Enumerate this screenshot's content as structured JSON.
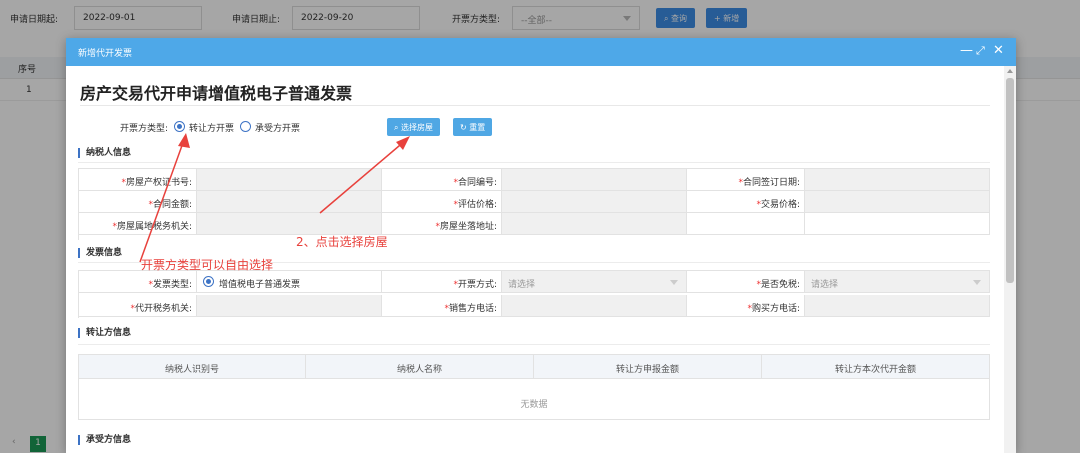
{
  "filter": {
    "start_label": "申请日期起:",
    "start_value": "2022-09-01",
    "end_label": "申请日期止:",
    "end_value": "2022-09-20",
    "type_label": "开票方类型:",
    "type_value": "--全部--",
    "search_button": "查询",
    "add_button": "新增"
  },
  "bg_table": {
    "col_no": "序号",
    "row_no": "1",
    "page_current": "1"
  },
  "modal": {
    "title": "新增代开发票",
    "doc_title": "房产交易代开申请增值税电子普通发票",
    "invoice_party_label": "开票方类型:",
    "option_transferor": "转让方开票",
    "option_transferee": "承受方开票",
    "select_house_button": "选择房屋",
    "reset_button": "重置",
    "taxpayer_section": "纳税人信息",
    "taxpayer_fields": {
      "cert_no": "房屋产权证书号:",
      "contract_no": "合同编号:",
      "contract_date": "合同签订日期:",
      "contract_amount": "合同金额:",
      "assessed_price": "评估价格:",
      "trade_price": "交易价格:",
      "tax_office": "房屋属地税务机关:",
      "address": "房屋坐落地址:"
    },
    "invoice_section": "发票信息",
    "invoice_fields": {
      "invoice_type": "发票类型:",
      "invoice_type_value": "增值税电子普通发票",
      "issue_method": "开票方式:",
      "issue_method_placeholder": "请选择",
      "tax_exempt": "是否免税:",
      "tax_exempt_placeholder": "请选择",
      "proxy_office": "代开税务机关:",
      "seller_phone": "销售方电话:",
      "buyer_phone": "购买方电话:"
    },
    "transferor_section": "转让方信息",
    "transferor_table": {
      "headers": [
        "纳税人识别号",
        "纳税人名称",
        "转让方申报金额",
        "转让方本次代开金额"
      ],
      "empty": "无数据"
    },
    "transferee_section": "承受方信息"
  },
  "annotations": {
    "step2": "2、点击选择房屋",
    "type_hint": "开票方类型可以自由选择"
  },
  "colors": {
    "modal_header": "#4ea8e8",
    "annotation": "#e8413c",
    "radio": "#3d73c5"
  }
}
